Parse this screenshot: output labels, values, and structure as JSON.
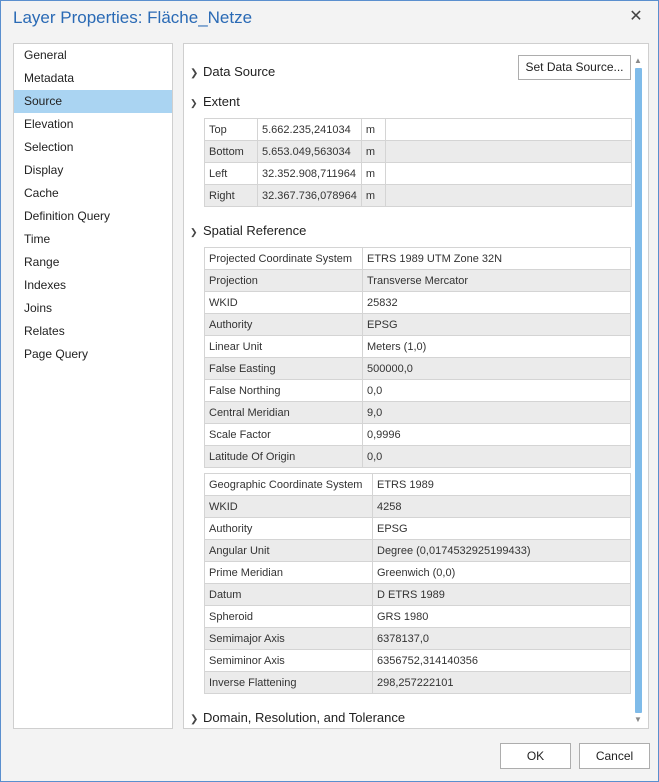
{
  "window": {
    "title": "Layer Properties: Fläche_Netze",
    "close_glyph": "✕"
  },
  "nav": {
    "items": [
      "General",
      "Metadata",
      "Source",
      "Elevation",
      "Selection",
      "Display",
      "Cache",
      "Definition Query",
      "Time",
      "Range",
      "Indexes",
      "Joins",
      "Relates",
      "Page Query"
    ],
    "selected": "Source"
  },
  "sections": {
    "data_source": {
      "title": "Data Source",
      "expanded": false,
      "set_button": "Set Data Source..."
    },
    "extent": {
      "title": "Extent",
      "expanded": true,
      "rows": [
        {
          "label": "Top",
          "value": "5.662.235,241034",
          "unit": "m"
        },
        {
          "label": "Bottom",
          "value": "5.653.049,563034",
          "unit": "m"
        },
        {
          "label": "Left",
          "value": "32.352.908,711964",
          "unit": "m"
        },
        {
          "label": "Right",
          "value": "32.367.736,078964",
          "unit": "m"
        }
      ]
    },
    "spatial_reference": {
      "title": "Spatial Reference",
      "expanded": true,
      "projected": [
        {
          "label": "Projected Coordinate System",
          "value": "ETRS 1989 UTM Zone 32N"
        },
        {
          "label": "Projection",
          "value": "Transverse Mercator"
        },
        {
          "label": "WKID",
          "value": "25832"
        },
        {
          "label": "Authority",
          "value": "EPSG"
        },
        {
          "label": "Linear Unit",
          "value": "Meters (1,0)"
        },
        {
          "label": "False Easting",
          "value": "500000,0"
        },
        {
          "label": "False Northing",
          "value": "0,0"
        },
        {
          "label": "Central Meridian",
          "value": "9,0"
        },
        {
          "label": "Scale Factor",
          "value": "0,9996"
        },
        {
          "label": "Latitude Of Origin",
          "value": "0,0"
        }
      ],
      "geographic": [
        {
          "label": "Geographic Coordinate System",
          "value": "ETRS 1989"
        },
        {
          "label": "WKID",
          "value": "4258"
        },
        {
          "label": "Authority",
          "value": "EPSG"
        },
        {
          "label": "Angular Unit",
          "value": "Degree (0,0174532925199433)"
        },
        {
          "label": "Prime Meridian",
          "value": "Greenwich (0,0)"
        },
        {
          "label": "Datum",
          "value": "D ETRS 1989"
        },
        {
          "label": "Spheroid",
          "value": "GRS 1980"
        },
        {
          "label": "Semimajor Axis",
          "value": "6378137,0"
        },
        {
          "label": "Semiminor Axis",
          "value": "6356752,314140356"
        },
        {
          "label": "Inverse Flattening",
          "value": "298,257222101"
        }
      ]
    },
    "domain": {
      "title": "Domain, Resolution, and Tolerance",
      "expanded": false
    }
  },
  "buttons": {
    "ok": "OK",
    "cancel": "Cancel"
  },
  "colors": {
    "accent": "#2a6ab5",
    "selection": "#aad4f2",
    "scroll_thumb": "#7fbbe9"
  }
}
